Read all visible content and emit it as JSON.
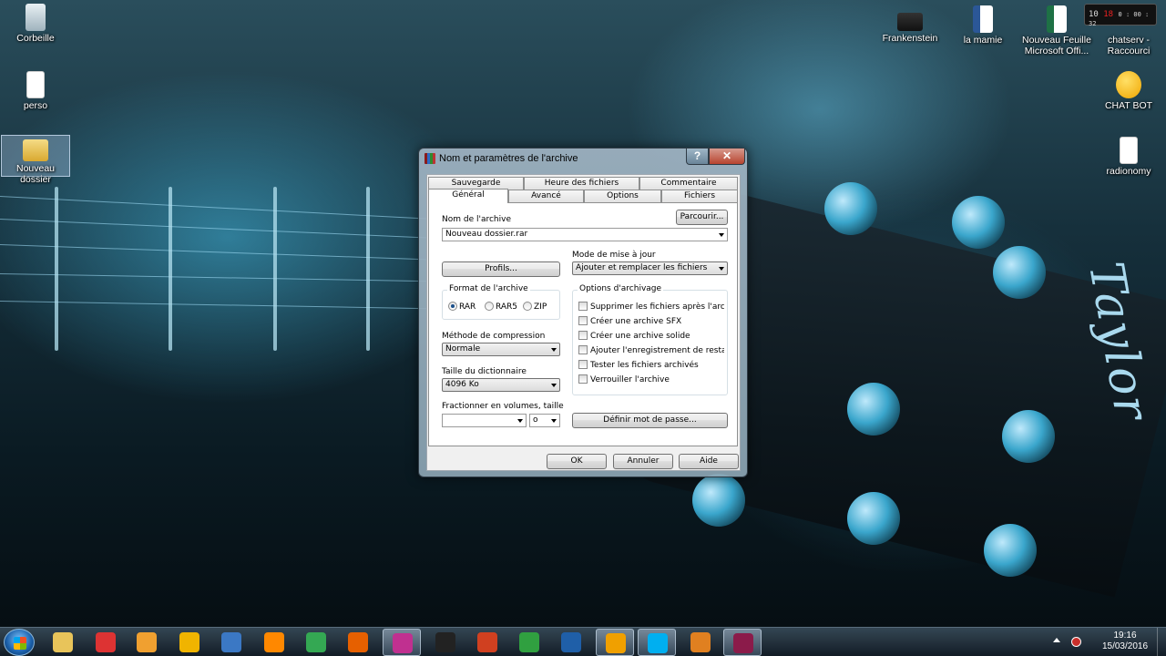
{
  "desktop": {
    "icons": [
      {
        "label": "Corbeille",
        "icon": "recycle-bin-icon"
      },
      {
        "label": "perso",
        "icon": "document-icon"
      },
      {
        "label": "Nouveau dossier",
        "icon": "folder-icon"
      },
      {
        "label": "Frankenstein",
        "icon": "clapperboard-icon"
      },
      {
        "label": "la mamie",
        "icon": "word-document-icon"
      },
      {
        "label": "Nouveau Feuille Microsoft Offi...",
        "icon": "excel-document-icon"
      },
      {
        "label": "chatserv - Raccourci",
        "icon": "shortcut-icon"
      },
      {
        "label": "CHAT BOT",
        "icon": "smiley-icon"
      },
      {
        "label": "radionomy",
        "icon": "document-icon"
      }
    ],
    "clock_widget": {
      "left": "10",
      "right": "0 : 00 : 32",
      "top_red": "18"
    },
    "brand_text": "Taylor"
  },
  "dialog": {
    "title": "Nom et paramètres de l'archive",
    "help_label": "?",
    "close_label": "✕",
    "tabs_row1": [
      "Sauvegarde",
      "Heure des fichiers",
      "Commentaire"
    ],
    "tabs_row2": [
      "Général",
      "Avancé",
      "Options",
      "Fichiers"
    ],
    "archive_name_label": "Nom de l'archive",
    "browse_button": "Parcourir...",
    "archive_name_value": "Nouveau dossier.rar",
    "update_mode_label": "Mode de mise à jour",
    "update_mode_value": "Ajouter et remplacer les fichiers",
    "profiles_button": "Profils...",
    "format_group": "Format de l'archive",
    "format_options": [
      {
        "label": "RAR",
        "selected": true
      },
      {
        "label": "RAR5",
        "selected": false
      },
      {
        "label": "ZIP",
        "selected": false
      }
    ],
    "archiving_options_group": "Options d'archivage",
    "archiving_options": [
      {
        "label": "Supprimer les fichiers après l'archivag",
        "checked": false
      },
      {
        "label": "Créer une archive SFX",
        "checked": false
      },
      {
        "label": "Créer une archive solide",
        "checked": false
      },
      {
        "label": "Ajouter l'enregistrement de restaurati",
        "checked": false
      },
      {
        "label": "Tester les fichiers archivés",
        "checked": false
      },
      {
        "label": "Verrouiller l'archive",
        "checked": false
      }
    ],
    "compression_label": "Méthode de compression",
    "compression_value": "Normale",
    "dictionary_label": "Taille du dictionnaire",
    "dictionary_value": "4096 Ko",
    "split_label": "Fractionner en volumes, taille",
    "split_value": "",
    "split_unit": "o",
    "password_button": "Définir mot de passe...",
    "ok_button": "OK",
    "cancel_button": "Annuler",
    "help_button": "Aide"
  },
  "taskbar": {
    "items": [
      {
        "icon": "explorer-folder-icon",
        "color": "#e8c45a"
      },
      {
        "icon": "media-record-icon",
        "color": "#d33"
      },
      {
        "icon": "video-player-icon",
        "color": "#f0a030"
      },
      {
        "icon": "smiley-icon",
        "color": "#f0b400"
      },
      {
        "icon": "thunderbird-icon",
        "color": "#3b78c4"
      },
      {
        "icon": "vlc-icon",
        "color": "#ff8800"
      },
      {
        "icon": "chrome-icon",
        "color": "#34a853"
      },
      {
        "icon": "firefox-icon",
        "color": "#e66000"
      },
      {
        "icon": "app-icon",
        "color": "#c03090"
      },
      {
        "icon": "guitar-app-icon",
        "color": "#222222"
      },
      {
        "icon": "ccleaner-icon",
        "color": "#d04020"
      },
      {
        "icon": "studio-icon",
        "color": "#30a040"
      },
      {
        "icon": "photoshop-icon",
        "color": "#1f5fa8"
      },
      {
        "icon": "circle-app-icon",
        "color": "#f0a000"
      },
      {
        "icon": "skype-icon",
        "color": "#00aff0"
      },
      {
        "icon": "ring-app-icon",
        "color": "#e08020"
      },
      {
        "icon": "winrar-icon",
        "color": "#8b1b4a"
      }
    ],
    "time": "19:16",
    "date": "15/03/2016"
  }
}
